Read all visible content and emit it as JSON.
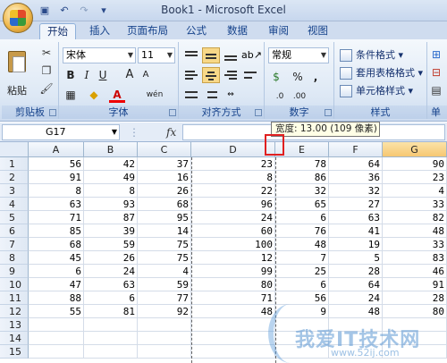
{
  "window": {
    "title": "Book1 - Microsoft Excel"
  },
  "tabs": [
    {
      "label": "开始",
      "active": true
    },
    {
      "label": "插入"
    },
    {
      "label": "页面布局"
    },
    {
      "label": "公式"
    },
    {
      "label": "数据"
    },
    {
      "label": "审阅"
    },
    {
      "label": "视图"
    }
  ],
  "ribbon": {
    "clipboard": {
      "paste_label": "粘贴",
      "group_label": "剪贴板"
    },
    "font": {
      "font_name": "宋体",
      "font_size": "11",
      "group_label": "字体",
      "bold": "B",
      "italic": "I",
      "underline": "U",
      "font_color_letter": "A",
      "grow": "A",
      "shrink": "A",
      "phonetic": "wén"
    },
    "alignment": {
      "group_label": "对齐方式"
    },
    "number": {
      "format": "常规",
      "currency": "$",
      "percent": "%",
      "comma": ",",
      "group_label": "数字"
    },
    "styles": {
      "cond_format": "条件格式",
      "table_format": "套用表格格式",
      "cell_styles": "单元格样式",
      "group_label": "样式"
    },
    "cells": {
      "group_label": "单"
    }
  },
  "formula_bar": {
    "name_box": "G17",
    "fx": "fx",
    "value": ""
  },
  "tooltip": "宽度: 13.00 (109 像素)",
  "columns": [
    "A",
    "B",
    "C",
    "D",
    "E",
    "F",
    "G"
  ],
  "rows": [
    {
      "n": "1",
      "cells": [
        "56",
        "42",
        "37",
        "23",
        "78",
        "64",
        "90"
      ]
    },
    {
      "n": "2",
      "cells": [
        "91",
        "49",
        "16",
        "8",
        "86",
        "36",
        "23"
      ]
    },
    {
      "n": "3",
      "cells": [
        "8",
        "8",
        "26",
        "22",
        "32",
        "32",
        "4"
      ]
    },
    {
      "n": "4",
      "cells": [
        "63",
        "93",
        "68",
        "96",
        "65",
        "27",
        "33"
      ]
    },
    {
      "n": "5",
      "cells": [
        "71",
        "87",
        "95",
        "24",
        "6",
        "63",
        "82"
      ]
    },
    {
      "n": "6",
      "cells": [
        "85",
        "39",
        "14",
        "60",
        "76",
        "41",
        "48"
      ]
    },
    {
      "n": "7",
      "cells": [
        "68",
        "59",
        "75",
        "100",
        "48",
        "19",
        "33"
      ]
    },
    {
      "n": "8",
      "cells": [
        "45",
        "26",
        "75",
        "12",
        "7",
        "5",
        "83"
      ]
    },
    {
      "n": "9",
      "cells": [
        "6",
        "24",
        "4",
        "99",
        "25",
        "28",
        "46"
      ]
    },
    {
      "n": "10",
      "cells": [
        "47",
        "63",
        "59",
        "80",
        "6",
        "64",
        "91"
      ]
    },
    {
      "n": "11",
      "cells": [
        "88",
        "6",
        "77",
        "71",
        "56",
        "24",
        "28"
      ]
    },
    {
      "n": "12",
      "cells": [
        "55",
        "81",
        "92",
        "48",
        "9",
        "48",
        "80"
      ]
    },
    {
      "n": "13",
      "cells": [
        "",
        "",
        "",
        "",
        "",
        "",
        ""
      ]
    },
    {
      "n": "14",
      "cells": [
        "",
        "",
        "",
        "",
        "",
        "",
        ""
      ]
    },
    {
      "n": "15",
      "cells": [
        "",
        "",
        "",
        "",
        "",
        "",
        ""
      ]
    }
  ],
  "watermark": {
    "main": "我爱IT技术网",
    "sub": "www.52ij.com"
  }
}
